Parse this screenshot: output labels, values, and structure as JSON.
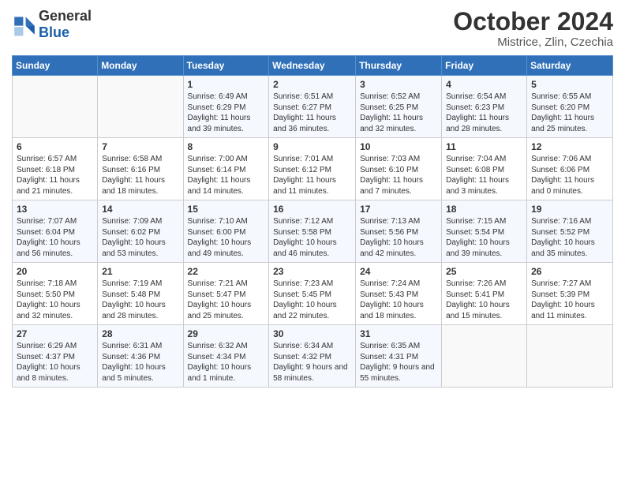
{
  "header": {
    "logo_general": "General",
    "logo_blue": "Blue",
    "month_title": "October 2024",
    "location": "Mistrice, Zlin, Czechia"
  },
  "days_of_week": [
    "Sunday",
    "Monday",
    "Tuesday",
    "Wednesday",
    "Thursday",
    "Friday",
    "Saturday"
  ],
  "weeks": [
    [
      {
        "day": "",
        "info": ""
      },
      {
        "day": "",
        "info": ""
      },
      {
        "day": "1",
        "info": "Sunrise: 6:49 AM\nSunset: 6:29 PM\nDaylight: 11 hours and 39 minutes."
      },
      {
        "day": "2",
        "info": "Sunrise: 6:51 AM\nSunset: 6:27 PM\nDaylight: 11 hours and 36 minutes."
      },
      {
        "day": "3",
        "info": "Sunrise: 6:52 AM\nSunset: 6:25 PM\nDaylight: 11 hours and 32 minutes."
      },
      {
        "day": "4",
        "info": "Sunrise: 6:54 AM\nSunset: 6:23 PM\nDaylight: 11 hours and 28 minutes."
      },
      {
        "day": "5",
        "info": "Sunrise: 6:55 AM\nSunset: 6:20 PM\nDaylight: 11 hours and 25 minutes."
      }
    ],
    [
      {
        "day": "6",
        "info": "Sunrise: 6:57 AM\nSunset: 6:18 PM\nDaylight: 11 hours and 21 minutes."
      },
      {
        "day": "7",
        "info": "Sunrise: 6:58 AM\nSunset: 6:16 PM\nDaylight: 11 hours and 18 minutes."
      },
      {
        "day": "8",
        "info": "Sunrise: 7:00 AM\nSunset: 6:14 PM\nDaylight: 11 hours and 14 minutes."
      },
      {
        "day": "9",
        "info": "Sunrise: 7:01 AM\nSunset: 6:12 PM\nDaylight: 11 hours and 11 minutes."
      },
      {
        "day": "10",
        "info": "Sunrise: 7:03 AM\nSunset: 6:10 PM\nDaylight: 11 hours and 7 minutes."
      },
      {
        "day": "11",
        "info": "Sunrise: 7:04 AM\nSunset: 6:08 PM\nDaylight: 11 hours and 3 minutes."
      },
      {
        "day": "12",
        "info": "Sunrise: 7:06 AM\nSunset: 6:06 PM\nDaylight: 11 hours and 0 minutes."
      }
    ],
    [
      {
        "day": "13",
        "info": "Sunrise: 7:07 AM\nSunset: 6:04 PM\nDaylight: 10 hours and 56 minutes."
      },
      {
        "day": "14",
        "info": "Sunrise: 7:09 AM\nSunset: 6:02 PM\nDaylight: 10 hours and 53 minutes."
      },
      {
        "day": "15",
        "info": "Sunrise: 7:10 AM\nSunset: 6:00 PM\nDaylight: 10 hours and 49 minutes."
      },
      {
        "day": "16",
        "info": "Sunrise: 7:12 AM\nSunset: 5:58 PM\nDaylight: 10 hours and 46 minutes."
      },
      {
        "day": "17",
        "info": "Sunrise: 7:13 AM\nSunset: 5:56 PM\nDaylight: 10 hours and 42 minutes."
      },
      {
        "day": "18",
        "info": "Sunrise: 7:15 AM\nSunset: 5:54 PM\nDaylight: 10 hours and 39 minutes."
      },
      {
        "day": "19",
        "info": "Sunrise: 7:16 AM\nSunset: 5:52 PM\nDaylight: 10 hours and 35 minutes."
      }
    ],
    [
      {
        "day": "20",
        "info": "Sunrise: 7:18 AM\nSunset: 5:50 PM\nDaylight: 10 hours and 32 minutes."
      },
      {
        "day": "21",
        "info": "Sunrise: 7:19 AM\nSunset: 5:48 PM\nDaylight: 10 hours and 28 minutes."
      },
      {
        "day": "22",
        "info": "Sunrise: 7:21 AM\nSunset: 5:47 PM\nDaylight: 10 hours and 25 minutes."
      },
      {
        "day": "23",
        "info": "Sunrise: 7:23 AM\nSunset: 5:45 PM\nDaylight: 10 hours and 22 minutes."
      },
      {
        "day": "24",
        "info": "Sunrise: 7:24 AM\nSunset: 5:43 PM\nDaylight: 10 hours and 18 minutes."
      },
      {
        "day": "25",
        "info": "Sunrise: 7:26 AM\nSunset: 5:41 PM\nDaylight: 10 hours and 15 minutes."
      },
      {
        "day": "26",
        "info": "Sunrise: 7:27 AM\nSunset: 5:39 PM\nDaylight: 10 hours and 11 minutes."
      }
    ],
    [
      {
        "day": "27",
        "info": "Sunrise: 6:29 AM\nSunset: 4:37 PM\nDaylight: 10 hours and 8 minutes."
      },
      {
        "day": "28",
        "info": "Sunrise: 6:31 AM\nSunset: 4:36 PM\nDaylight: 10 hours and 5 minutes."
      },
      {
        "day": "29",
        "info": "Sunrise: 6:32 AM\nSunset: 4:34 PM\nDaylight: 10 hours and 1 minute."
      },
      {
        "day": "30",
        "info": "Sunrise: 6:34 AM\nSunset: 4:32 PM\nDaylight: 9 hours and 58 minutes."
      },
      {
        "day": "31",
        "info": "Sunrise: 6:35 AM\nSunset: 4:31 PM\nDaylight: 9 hours and 55 minutes."
      },
      {
        "day": "",
        "info": ""
      },
      {
        "day": "",
        "info": ""
      }
    ]
  ]
}
